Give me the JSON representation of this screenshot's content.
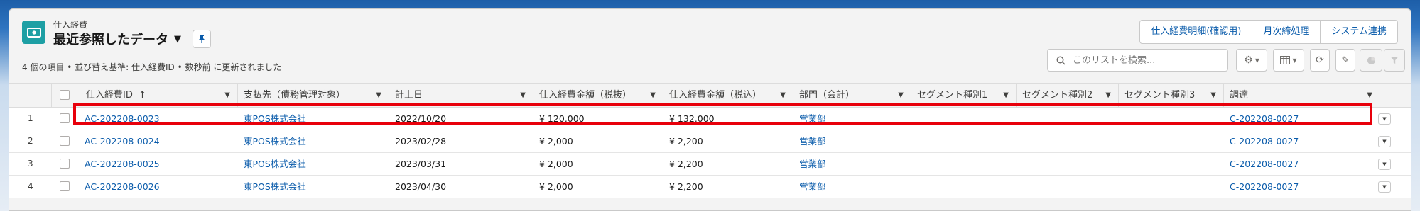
{
  "header": {
    "object_label": "仕入経費",
    "list_title": "最近参照したデータ",
    "subinfo": "4 個の項目 • 並び替え基準: 仕入経費ID • 数秒前 に更新されました"
  },
  "actions": [
    "仕入経費明細(確認用)",
    "月次締処理",
    "システム連携"
  ],
  "search": {
    "placeholder": "このリストを検索..."
  },
  "columns": [
    {
      "label": "仕入経費ID",
      "sort": "↑"
    },
    {
      "label": "支払先（債務管理対象）"
    },
    {
      "label": "計上日"
    },
    {
      "label": "仕入経費金額（税抜）"
    },
    {
      "label": "仕入経費金額（税込）"
    },
    {
      "label": "部門（会計）"
    },
    {
      "label": "セグメント種別1"
    },
    {
      "label": "セグメント種別2"
    },
    {
      "label": "セグメント種別3"
    },
    {
      "label": "調達"
    }
  ],
  "rows": [
    {
      "num": "1",
      "id": "AC-202208-0023",
      "payee": "東POS株式会社",
      "date": "2022/10/20",
      "ex": "¥ 120,000",
      "inc": "¥ 132,000",
      "dept": "営業部",
      "proc": "C-202208-0027"
    },
    {
      "num": "2",
      "id": "AC-202208-0024",
      "payee": "東POS株式会社",
      "date": "2023/02/28",
      "ex": "¥ 2,000",
      "inc": "¥ 2,200",
      "dept": "営業部",
      "proc": "C-202208-0027"
    },
    {
      "num": "3",
      "id": "AC-202208-0025",
      "payee": "東POS株式会社",
      "date": "2023/03/31",
      "ex": "¥ 2,000",
      "inc": "¥ 2,200",
      "dept": "営業部",
      "proc": "C-202208-0027"
    },
    {
      "num": "4",
      "id": "AC-202208-0026",
      "payee": "東POS株式会社",
      "date": "2023/04/30",
      "ex": "¥ 2,000",
      "inc": "¥ 2,200",
      "dept": "営業部",
      "proc": "C-202208-0027"
    }
  ],
  "colors": {
    "link": "#0b5cab",
    "object_icon": "#1d9fa4",
    "highlight": "#e8000b"
  }
}
